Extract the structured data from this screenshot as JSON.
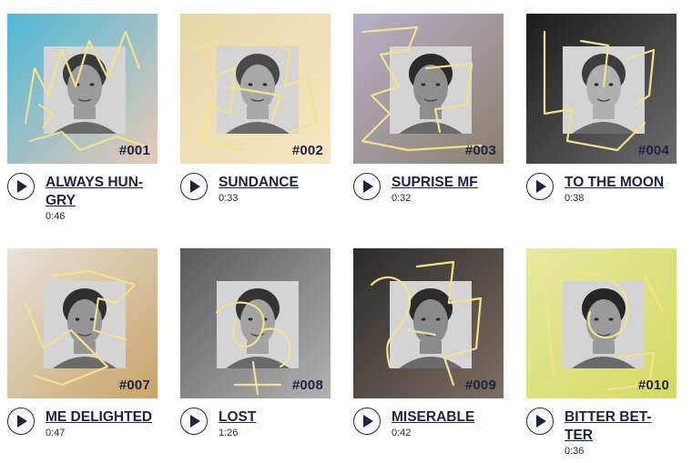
{
  "colors": {
    "ink": "#1d2440",
    "scribble": "#f2e28c"
  },
  "cards": [
    {
      "number": "#001",
      "title": "ALWAYS HUN-GRY",
      "duration": "0:46",
      "bg": "#4fb8d8",
      "bg2": "#e8c9b6"
    },
    {
      "number": "#002",
      "title": "SUNDANCE",
      "duration": "0:33",
      "bg": "#e9d6a8",
      "bg2": "#f5e7c2"
    },
    {
      "number": "#003",
      "title": "SUPRISE MF",
      "duration": "0:32",
      "bg": "#b8b0c8",
      "bg2": "#8a7f6e"
    },
    {
      "number": "#004",
      "title": "TO THE MOON",
      "duration": "0:38",
      "bg": "#1b1b1b",
      "bg2": "#6c6c6c"
    },
    {
      "number": "#007",
      "title": "ME DELIGHTED",
      "duration": "0:47",
      "bg": "#e7e2da",
      "bg2": "#c9a368"
    },
    {
      "number": "#008",
      "title": "LOST",
      "duration": "1:26",
      "bg": "#5a5a5a",
      "bg2": "#b2b2b2"
    },
    {
      "number": "#009",
      "title": "MISERABLE",
      "duration": "0:42",
      "bg": "#2a2a2a",
      "bg2": "#7d6e62"
    },
    {
      "number": "#010",
      "title": "BITTER BET-TER",
      "duration": "0:36",
      "bg": "#e6e9a0",
      "bg2": "#d3da62"
    }
  ]
}
